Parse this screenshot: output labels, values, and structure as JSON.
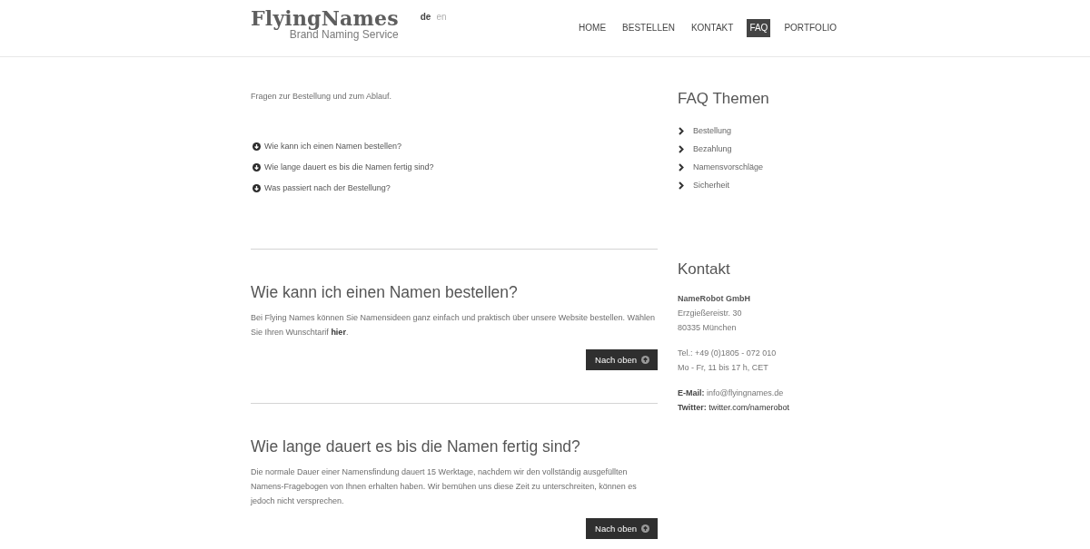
{
  "header": {
    "logo": {
      "wordmark": "FlyingNames",
      "tagline": "Brand Naming Service"
    },
    "languages": [
      {
        "label": "de",
        "selected": true
      },
      {
        "label": "en",
        "selected": false
      }
    ],
    "nav": [
      {
        "label": "HOME",
        "selected": false
      },
      {
        "label": "BESTELLEN",
        "selected": false
      },
      {
        "label": "KONTAKT",
        "selected": false
      },
      {
        "label": "FAQ",
        "selected": true
      },
      {
        "label": "PORTFOLIO",
        "selected": false
      }
    ]
  },
  "intro": "Fragen zur Bestellung und zum Ablauf.",
  "question_links": [
    "Wie kann ich einen Namen bestellen?",
    "Wie lange dauert es bis die Namen fertig sind?",
    "Was passiert nach der Bestellung?"
  ],
  "sections": [
    {
      "title": "Wie kann ich einen Namen bestellen?",
      "body": "Bei Flying Names können Sie Namensideen ganz einfach und praktisch über unsere Website bestellen. Wählen Sie Ihren Wunschtarif **hier**.",
      "button": "Nach oben"
    },
    {
      "title": "Wie lange dauert es bis die Namen fertig sind?",
      "body": "Die normale Dauer einer Namensfindung dauert 15 Werktage, nachdem wir den vollständig ausgefüllten Namens-Fragebogen von Ihnen erhalten haben. Wir bemühen uns diese Zeit zu unterschreiten, können es jedoch nicht versprechen.",
      "button": "Nach oben"
    }
  ],
  "sidebar": {
    "faq_topics": {
      "title": "FAQ Themen",
      "items": [
        "Bestellung",
        "Bezahlung",
        "Namensvorschläge",
        "Sicherheit"
      ]
    },
    "contact": {
      "title": "Kontakt",
      "groups": [
        {
          "lines": [
            {
              "kind": "name",
              "text": "NameRobot GmbH"
            },
            {
              "kind": "plain",
              "text": "Erzgießereistr. 30"
            },
            {
              "kind": "plain",
              "text": "80335 München"
            }
          ]
        },
        {
          "lines": [
            {
              "kind": "plain",
              "text": "Tel.: +49 (0)1805 - 072 010"
            },
            {
              "kind": "plain",
              "text": "Mo - Fr, 11 bis 17 h, CET"
            }
          ]
        },
        {
          "lines": [
            {
              "kind": "labeled",
              "label": "E-Mail:",
              "value": "info@flyingnames.de"
            },
            {
              "kind": "link",
              "label": "Twitter:",
              "value": "twitter.com/namerobot"
            }
          ]
        }
      ]
    }
  }
}
